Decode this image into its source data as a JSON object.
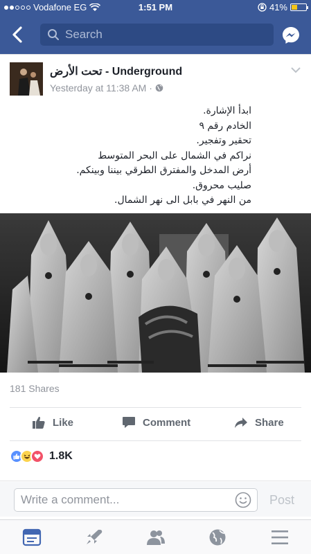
{
  "status_bar": {
    "carrier": "Vodafone EG",
    "time": "1:51 PM",
    "battery": "41%",
    "battery_level": 0.41
  },
  "navbar": {
    "search_placeholder": "Search",
    "back_icon": "chevron-left-icon",
    "messenger_icon": "messenger-icon"
  },
  "post": {
    "author": "تحت الأرض - Underground",
    "timestamp": "Yesterday at 11:38 AM ·",
    "privacy_icon": "globe-icon",
    "lines": [
      "ابدأ الإشارة.",
      "الخادم رقم ٩",
      "تحقير وتفجير.",
      "نراكم في الشمال على البحر المتوسط",
      "أرض المدخل والمفترق الطرقي بيننا وبينكم.",
      "صليب محروق.",
      "من النهر في بابل الى نهر الشمال."
    ],
    "shares": "181 Shares",
    "reaction_count": "1.8K"
  },
  "actions": {
    "like": "Like",
    "comment": "Comment",
    "share": "Share"
  },
  "composer": {
    "placeholder": "Write a comment...",
    "post_label": "Post"
  },
  "colors": {
    "brand": "#3b5998",
    "muted": "#90949c",
    "action": "#606770",
    "like_blue": "#5890ff",
    "love_red": "#f25268",
    "haha_yellow": "#fcd34d"
  },
  "tabs": [
    "news-feed-icon",
    "explore-icon",
    "friends-icon",
    "notifications-globe-icon",
    "menu-icon"
  ]
}
